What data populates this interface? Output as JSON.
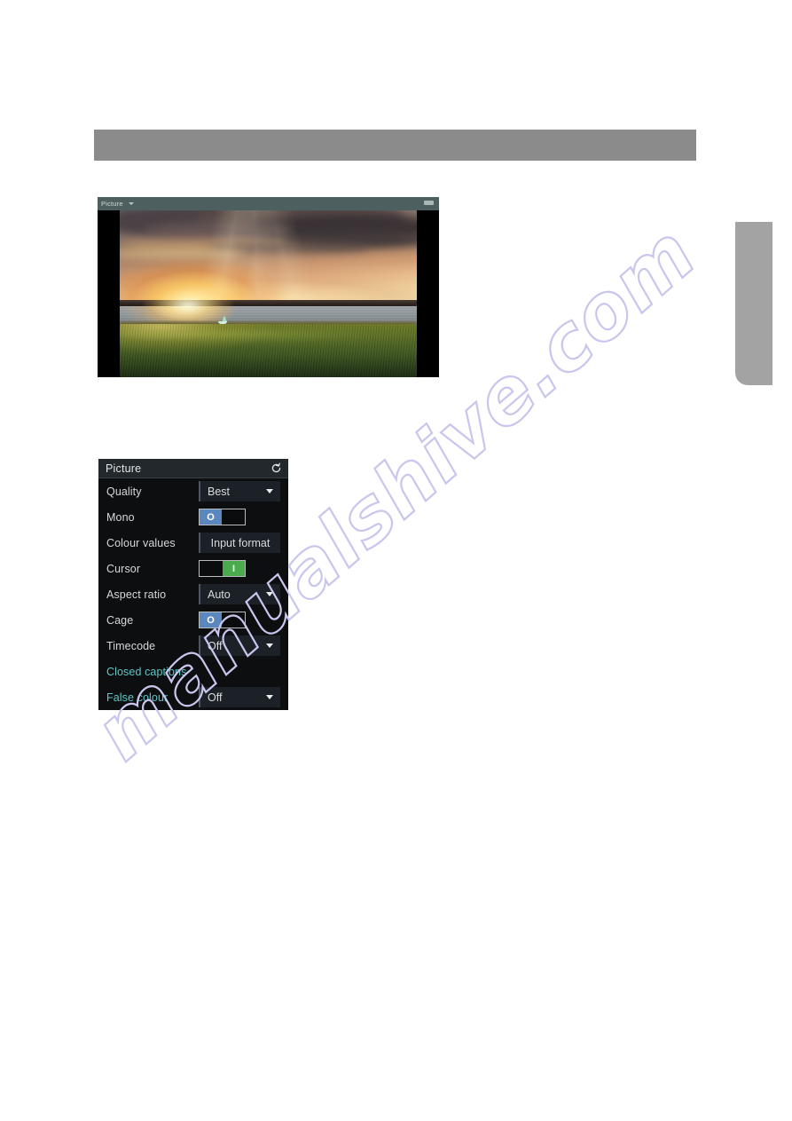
{
  "page": {
    "watermark_text": "manualshive.com"
  },
  "header_bar": {
    "label": ""
  },
  "side_tab": {
    "label": ""
  },
  "preview_window": {
    "title": "Picture",
    "title_caret_icon": "chevron-down-icon",
    "minimize_icon": "minimize-icon",
    "image_description": "Sunset over water with grassy foreground, pillarboxed with black bars"
  },
  "settings_panel": {
    "title": "Picture",
    "reset_icon": "reset-refresh-icon",
    "rows": [
      {
        "label": "Quality",
        "control": "dropdown",
        "value": "Best",
        "label_color": "#d5d9db",
        "caret_icon": "chevron-down-icon"
      },
      {
        "label": "Mono",
        "control": "toggle",
        "value": "off",
        "knob_glyph": "O",
        "label_color": "#d5d9db",
        "knob_color": "#5b87bf"
      },
      {
        "label": "Colour values",
        "control": "value",
        "value": "Input format",
        "label_color": "#d5d9db"
      },
      {
        "label": "Cursor",
        "control": "toggle",
        "value": "on",
        "knob_glyph": "I",
        "label_color": "#d5d9db",
        "knob_color": "#49aa4e"
      },
      {
        "label": "Aspect ratio",
        "control": "dropdown",
        "value": "Auto",
        "label_color": "#d5d9db",
        "caret_icon": "chevron-down-icon"
      },
      {
        "label": "Cage",
        "control": "toggle",
        "value": "off",
        "knob_glyph": "O",
        "label_color": "#d5d9db",
        "knob_color": "#5b87bf"
      },
      {
        "label": "Timecode",
        "control": "dropdown",
        "value": "Off",
        "label_color": "#d5d9db",
        "caret_icon": "chevron-down-icon"
      },
      {
        "label": "Closed captions",
        "control": "none",
        "value": "",
        "label_color": "#5fc7c7"
      },
      {
        "label": "False colour",
        "control": "dropdown",
        "value": "Off",
        "label_color": "#5fc7c7",
        "caret_icon": "chevron-down-icon"
      }
    ]
  }
}
